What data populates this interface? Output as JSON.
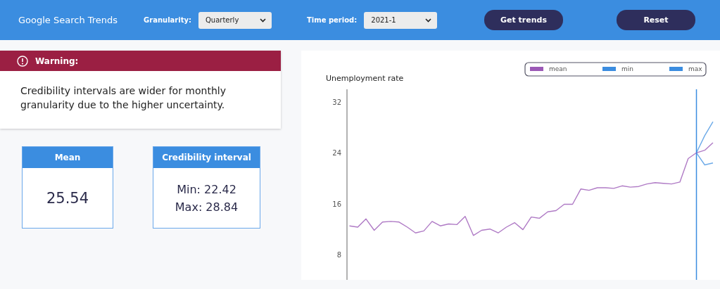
{
  "header": {
    "title": "Google Search Trends",
    "controls": [
      {
        "label": "Granularity:",
        "value": "Quarterly"
      },
      {
        "label": "Time period:",
        "value": "2021-1"
      }
    ],
    "buttons": [
      "Get trends",
      "Reset"
    ]
  },
  "warning": {
    "title": "Warning:",
    "message": "Credibility intervals are wider for monthly granularity due to the higher uncertainty."
  },
  "stats": [
    {
      "title": "Mean",
      "lines": [
        "25.54"
      ]
    },
    {
      "title": "Credibility interval",
      "lines": [
        "Min: 22.42",
        "Max: 28.84"
      ]
    }
  ],
  "chart": {
    "chart_data": {
      "type": "line",
      "ylabel": "Unemployment rate",
      "ylim": [
        4,
        34
      ],
      "legend": "top-right",
      "yticks": [
        8,
        16,
        24,
        32
      ],
      "series": [
        {
          "name": "mean",
          "color": "#9b59b6",
          "values": [
            12.5,
            12.3,
            13.6,
            11.8,
            13.1,
            13.2,
            13.1,
            12.3,
            11.4,
            11.7,
            13.2,
            12.5,
            12.8,
            12.7,
            14.0,
            11.0,
            11.8,
            12.0,
            11.4,
            12.3,
            13.0,
            11.9,
            13.9,
            13.7,
            14.7,
            14.9,
            15.9,
            15.9,
            18.3,
            18.1,
            18.5,
            18.5,
            18.4,
            18.8,
            18.6,
            18.7,
            19.1,
            19.3,
            19.2,
            19.1,
            19.4,
            23.1,
            24.0,
            24.4,
            25.6
          ]
        },
        {
          "name": "min",
          "color": "#3b8de0",
          "values": [
            null,
            null,
            null,
            null,
            null,
            null,
            null,
            null,
            null,
            null,
            null,
            null,
            null,
            null,
            null,
            null,
            null,
            null,
            null,
            null,
            null,
            null,
            null,
            null,
            null,
            null,
            null,
            null,
            null,
            null,
            null,
            null,
            null,
            null,
            null,
            null,
            null,
            null,
            null,
            null,
            null,
            null,
            24.0,
            22.1,
            22.4
          ]
        },
        {
          "name": "max",
          "color": "#3b8de0",
          "values": [
            null,
            null,
            null,
            null,
            null,
            null,
            null,
            null,
            null,
            null,
            null,
            null,
            null,
            null,
            null,
            null,
            null,
            null,
            null,
            null,
            null,
            null,
            null,
            null,
            null,
            null,
            null,
            null,
            null,
            null,
            null,
            null,
            null,
            null,
            null,
            null,
            null,
            null,
            null,
            null,
            null,
            null,
            24.0,
            26.7,
            28.9
          ]
        }
      ]
    }
  }
}
